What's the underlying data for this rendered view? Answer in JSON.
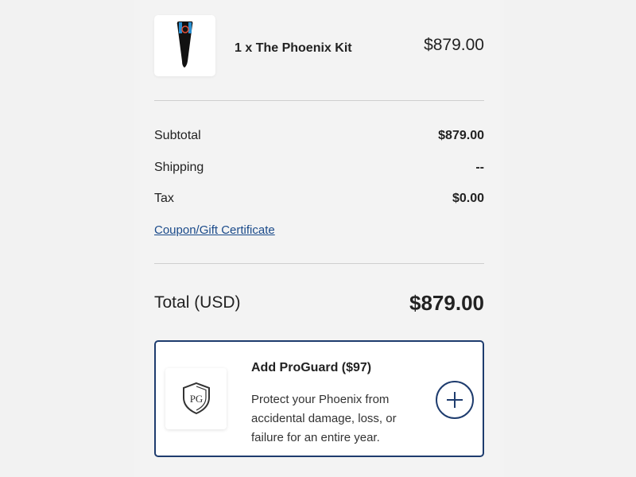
{
  "cart": {
    "item": {
      "quantity_name": "1 x The Phoenix Kit",
      "price": "$879.00",
      "image_icon": "phoenix-device-icon"
    },
    "summary": {
      "subtotal_label": "Subtotal",
      "subtotal_value": "$879.00",
      "shipping_label": "Shipping",
      "shipping_value": "--",
      "tax_label": "Tax",
      "tax_value": "$0.00",
      "coupon_link": "Coupon/Gift Certificate"
    },
    "total": {
      "label": "Total (USD)",
      "value": "$879.00"
    },
    "proguard": {
      "title": "Add ProGuard ($97)",
      "description": "Protect your Phoenix from accidental damage, loss, or failure for an entire year.",
      "logo_icon": "proguard-shield-icon",
      "add_icon": "plus-icon"
    }
  },
  "colors": {
    "accent": "#1e3c6e",
    "link": "#1a4a8a",
    "background": "#f2f2f2"
  }
}
